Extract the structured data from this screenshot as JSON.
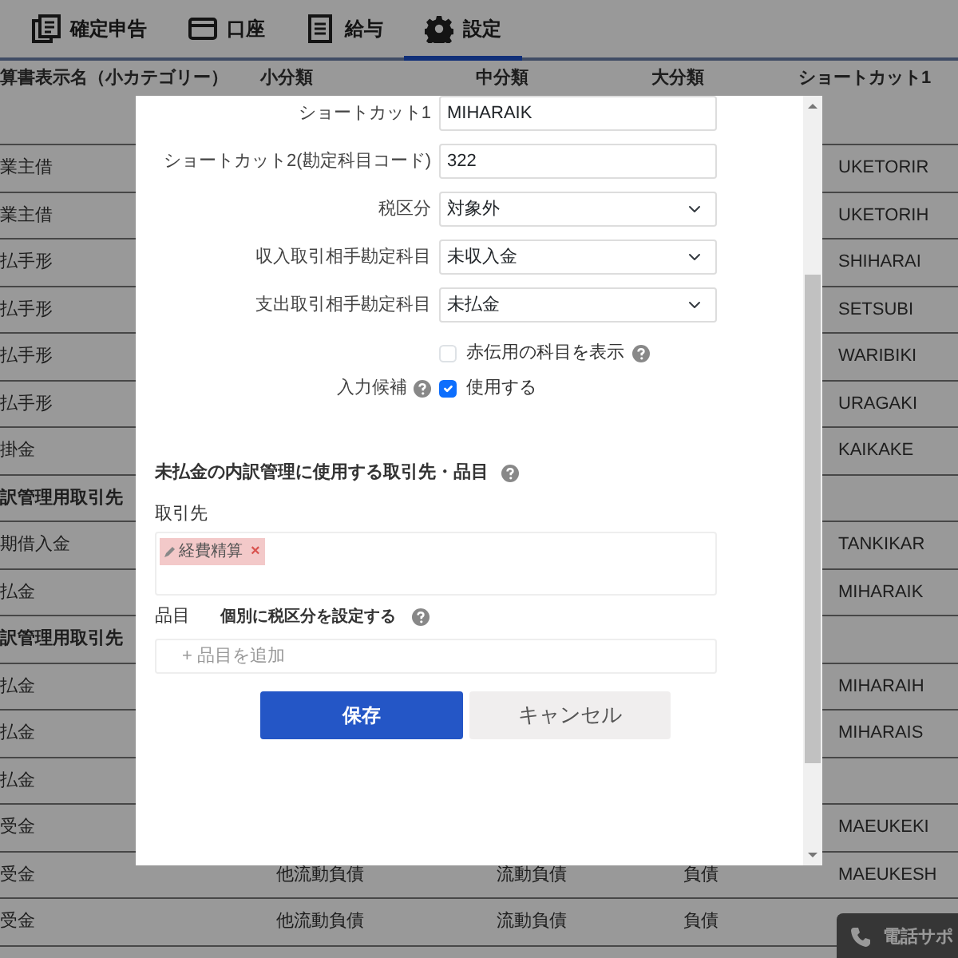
{
  "nav_tabs": [
    {
      "label": "確定申告",
      "selected": false
    },
    {
      "label": "口座",
      "selected": false
    },
    {
      "label": "給与",
      "selected": false
    },
    {
      "label": "設定",
      "selected": true
    }
  ],
  "table": {
    "columns": [
      "算書表示名（小カテゴリー）",
      "小分類",
      "中分類",
      "大分類",
      "ショートカット1"
    ],
    "rows": [
      {
        "kind": "item",
        "account": "業主借",
        "shortcut": "UKETORIR"
      },
      {
        "kind": "item",
        "account": "業主借",
        "shortcut": "UKETORIH"
      },
      {
        "kind": "item",
        "account": "払手形",
        "shortcut": "SHIHARAI"
      },
      {
        "kind": "item",
        "account": "払手形",
        "shortcut": "SETSUBI"
      },
      {
        "kind": "item",
        "account": "払手形",
        "shortcut": "WARIBIKI"
      },
      {
        "kind": "item",
        "account": "払手形",
        "shortcut": "URAGAKI"
      },
      {
        "kind": "item",
        "account": "掛金",
        "shortcut": "KAIKAKE"
      },
      {
        "kind": "group",
        "account": "訳管理用取引先"
      },
      {
        "kind": "item",
        "account": "期借入金",
        "shortcut": "TANKIKAR"
      },
      {
        "kind": "item",
        "account": "払金",
        "shortcut": "MIHARAIK"
      },
      {
        "kind": "group",
        "account": "訳管理用取引先"
      },
      {
        "kind": "item",
        "account": "払金",
        "shortcut": "MIHARAIH"
      },
      {
        "kind": "item",
        "account": "払金",
        "shortcut": "MIHARAIS"
      },
      {
        "kind": "item",
        "account": "払金"
      },
      {
        "kind": "item",
        "account": "受金",
        "shortcut": "MAEUKEKI"
      },
      {
        "kind": "item",
        "account": "受金",
        "small": "他流動負債",
        "middle": "流動負債",
        "large": "負債",
        "shortcut": "MAEUKESH"
      },
      {
        "kind": "item",
        "account": "受金",
        "small": "他流動負債",
        "middle": "流動負債",
        "large": "負債"
      }
    ]
  },
  "phone_support": {
    "label": "電話サポ"
  },
  "modal": {
    "fields": [
      {
        "kind": "text",
        "label": "ショートカット1",
        "value": "MIHARAIK"
      },
      {
        "kind": "text",
        "label": "ショートカット2(勘定科目コード)",
        "value": "322"
      },
      {
        "kind": "select",
        "label": "税区分",
        "value": "対象外"
      },
      {
        "kind": "select",
        "label": "収入取引相手勘定科目",
        "value": "未収入金"
      },
      {
        "kind": "select",
        "label": "支出取引相手勘定科目",
        "value": "未払金"
      }
    ],
    "checkboxes": [
      {
        "text": "赤伝用の科目を表示",
        "checked": false,
        "help": true
      },
      {
        "label": "入力候補",
        "label_help": true,
        "text": "使用する",
        "checked": true,
        "help": false
      }
    ],
    "section_title": "未払金の内訳管理に使用する取引先・品目",
    "partner_label": "取引先",
    "partner_tags": [
      {
        "label": "経費精算",
        "remove": "×"
      }
    ],
    "item_label": "品目",
    "tax_toggle_label": "個別に税区分を設定する",
    "add_item": "+ 品目を追加",
    "buttons": [
      {
        "kind": "primary",
        "label": "保存"
      },
      {
        "kind": "secondary",
        "label": "キャンセル"
      }
    ]
  }
}
